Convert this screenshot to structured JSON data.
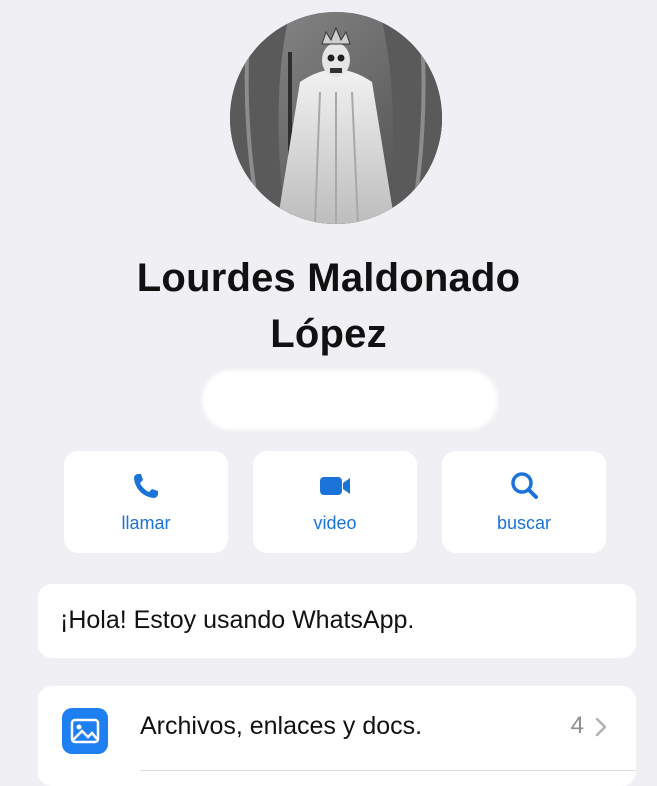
{
  "contact": {
    "name_line1": "Lourdes Maldonado",
    "name_line2": "López"
  },
  "actions": [
    {
      "label": "llamar",
      "icon": "phone-icon"
    },
    {
      "label": "video",
      "icon": "video-camera-icon"
    },
    {
      "label": "buscar",
      "icon": "search-icon"
    }
  ],
  "status": {
    "text": "¡Hola! Estoy usando WhatsApp."
  },
  "media": {
    "label": "Archivos, enlaces y docs.",
    "count": "4",
    "icon": "photo-gallery-icon"
  },
  "colors": {
    "accent": "#1a73d9",
    "background": "#efeff4",
    "card": "#ffffff",
    "media_icon_bg": "#1e7ff0"
  }
}
